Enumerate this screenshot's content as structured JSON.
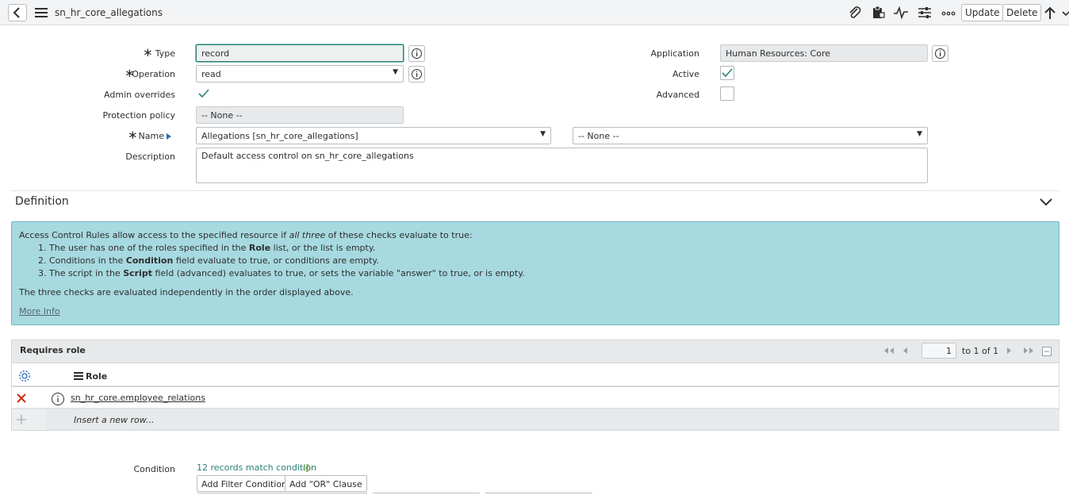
{
  "header": {
    "title": "sn_hr_core_allegations",
    "update_label": "Update",
    "delete_label": "Delete"
  },
  "form": {
    "type": {
      "label": "Type",
      "value": "record"
    },
    "operation": {
      "label": "Operation",
      "value": "read"
    },
    "admin_overrides": {
      "label": "Admin overrides",
      "checked": true
    },
    "protection_policy": {
      "label": "Protection policy",
      "value": "-- None --"
    },
    "name": {
      "label": "Name",
      "table_value": "Allegations [sn_hr_core_allegations]",
      "field_value": "-- None --"
    },
    "description": {
      "label": "Description",
      "value": "Default access control on sn_hr_core_allegations"
    },
    "application": {
      "label": "Application",
      "value": "Human Resources: Core"
    },
    "active": {
      "label": "Active",
      "checked": true
    },
    "advanced": {
      "label": "Advanced",
      "checked": false
    }
  },
  "definition": {
    "title": "Definition",
    "intro_prefix": "Access Control Rules allow access to the specified resource if ",
    "intro_emphasis": "all three",
    "intro_suffix": " of these checks evaluate to true:",
    "items": [
      {
        "num": "1.",
        "before": "The user has one of the roles specified in the ",
        "bold": "Role",
        "after": " list, or the list is empty."
      },
      {
        "num": "2.",
        "before": "Conditions in the ",
        "bold": "Condition",
        "after": " field evaluate to true, or conditions are empty."
      },
      {
        "num": "3.",
        "before": "The script in the ",
        "bold": "Script",
        "after": " field (advanced) evaluates to true, or sets the variable \"answer\" to true, or is empty."
      }
    ],
    "footer": "The three checks are evaluated independently in the order displayed above.",
    "more_info": "More Info"
  },
  "requires_role": {
    "title": "Requires role",
    "page": "1",
    "page_of": "to 1 of 1",
    "column_header": "Role",
    "rows": [
      "sn_hr_core.employee_relations"
    ],
    "insert_placeholder": "Insert a new row..."
  },
  "condition": {
    "label": "Condition",
    "match_text": "12 records match condition",
    "add_filter_label": "Add Filter Condition",
    "add_or_label": "Add \"OR\" Clause"
  },
  "colors": {
    "header_bg": "#f3f4f5",
    "info_bg": "#a7d9e0",
    "delete_red": "#d0271d",
    "link_green": "#2c7f77"
  }
}
